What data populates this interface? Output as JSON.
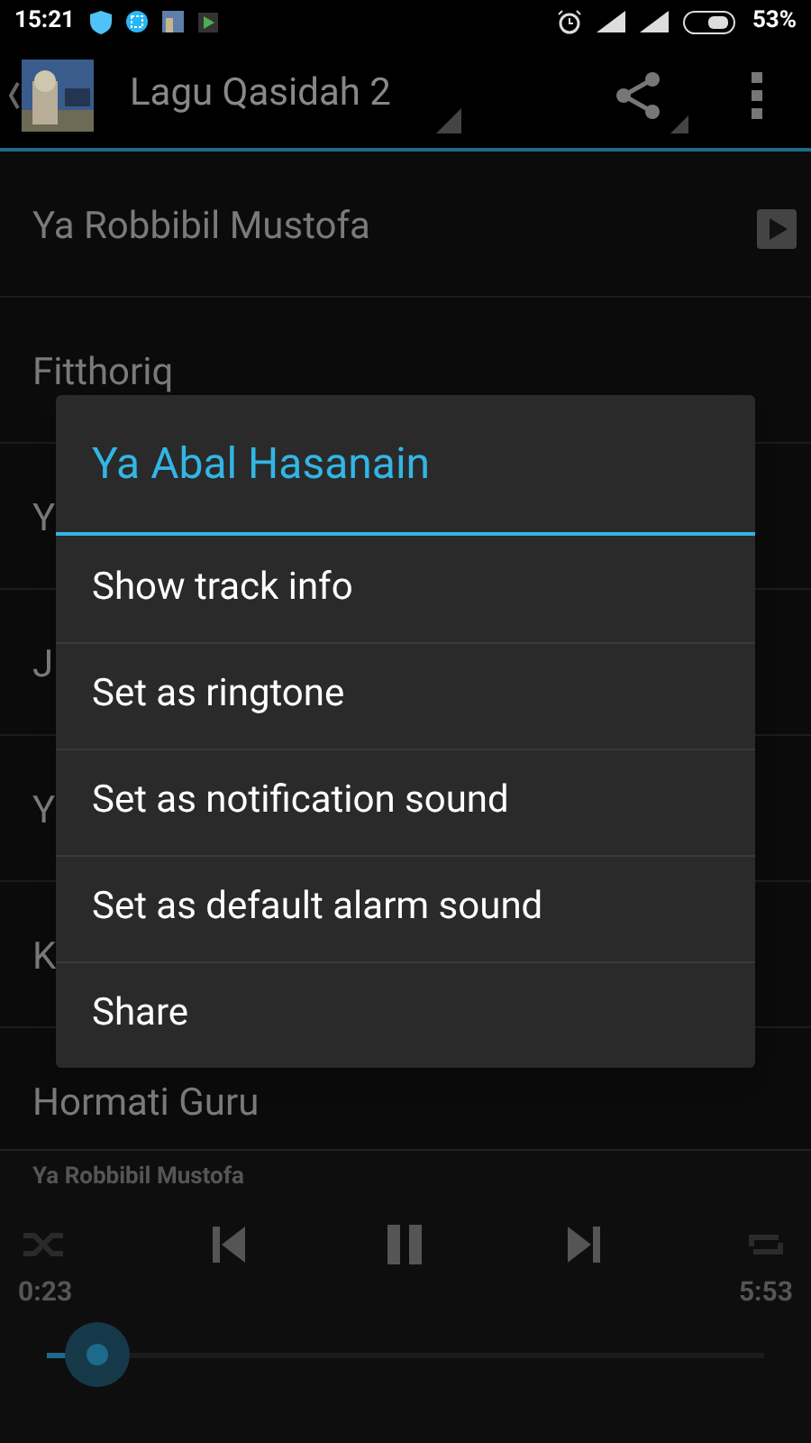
{
  "status_bar": {
    "time": "15:21",
    "battery": "53%"
  },
  "action_bar": {
    "title": "Lagu Qasidah 2"
  },
  "tracks": [
    {
      "title": "Ya Robbibil Mustofa",
      "playing": true
    },
    {
      "title": "Fitthoriq",
      "playing": false
    },
    {
      "title": "Y",
      "playing": false
    },
    {
      "title": "J",
      "playing": false
    },
    {
      "title": "Y",
      "playing": false
    },
    {
      "title": "K",
      "playing": false
    },
    {
      "title": "Hormati Guru",
      "playing": false
    }
  ],
  "dialog": {
    "title": "Ya Abal Hasanain",
    "items": [
      "Show track info",
      "Set as ringtone",
      "Set as notification sound",
      "Set as default alarm sound",
      "Share"
    ]
  },
  "player": {
    "now_playing": "Ya Robbibil Mustofa",
    "elapsed": "0:23",
    "duration": "5:53",
    "seek": {
      "level": 0.07
    }
  }
}
